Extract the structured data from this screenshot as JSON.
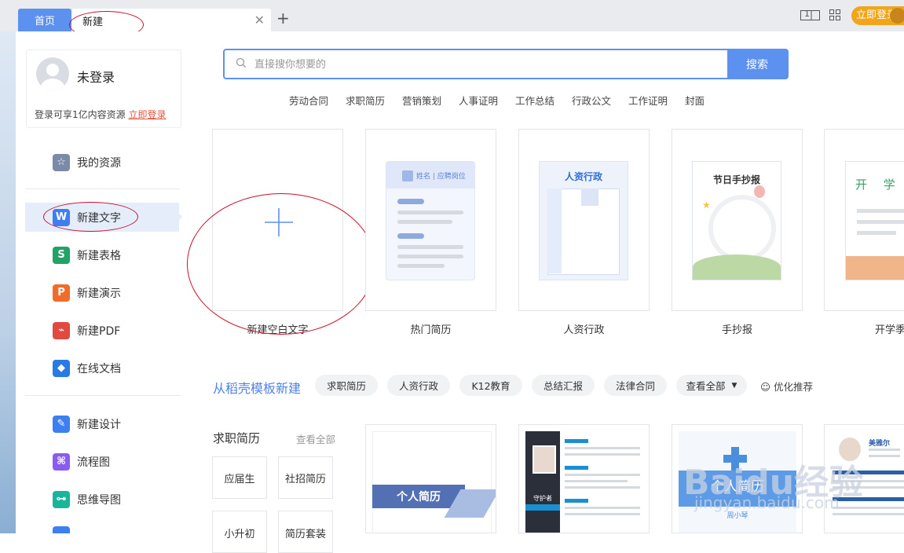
{
  "tabs": {
    "home": "首页",
    "new": "新建"
  },
  "top_right": {
    "screen_icon_label": "1",
    "login": "立即登录"
  },
  "user": {
    "name": "未登录",
    "tip_prefix": "登录可享1亿内容资源",
    "tip_link": "立即登录"
  },
  "sidebar": {
    "items": [
      {
        "label": "我的资源",
        "icon": "star-icon",
        "color": "#7b8aa6"
      },
      {
        "label": "新建文字",
        "icon": "w-icon",
        "color": "#3f7ef0"
      },
      {
        "label": "新建表格",
        "icon": "s-icon",
        "color": "#21a366"
      },
      {
        "label": "新建演示",
        "icon": "p-icon",
        "color": "#ef6c2b"
      },
      {
        "label": "新建PDF",
        "icon": "pdf-icon",
        "color": "#e24a3f"
      },
      {
        "label": "在线文档",
        "icon": "cube-icon",
        "color": "#2a7ae4"
      },
      {
        "label": "新建设计",
        "icon": "design-icon",
        "color": "#3d7ef0"
      },
      {
        "label": "流程图",
        "icon": "flowchart-icon",
        "color": "#8a5cf0"
      },
      {
        "label": "思维导图",
        "icon": "mindmap-icon",
        "color": "#19b59a"
      }
    ]
  },
  "search": {
    "placeholder": "直接搜你想要的",
    "button": "搜索"
  },
  "hot_links": [
    "劳动合同",
    "求职简历",
    "营销策划",
    "人事证明",
    "工作总结",
    "行政公文",
    "工作证明",
    "封面"
  ],
  "cards": [
    {
      "label": "新建空白文字"
    },
    {
      "label": "热门简历",
      "inner": "姓名 | 应聘岗位"
    },
    {
      "label": "人资行政",
      "inner": "人资行政"
    },
    {
      "label": "手抄报",
      "inner": "节日手抄报"
    },
    {
      "label": "开学季",
      "inner": "开 学"
    }
  ],
  "template_section": {
    "title": "从稻壳模板新建",
    "chips": [
      "求职简历",
      "人资行政",
      "K12教育",
      "总结汇报",
      "法律合同",
      "查看全部"
    ],
    "recommend": "优化推荐"
  },
  "resume_section": {
    "title": "求职简历",
    "view_all": "查看全部",
    "tags": [
      "应届生",
      "社招简历",
      "小升初",
      "简历套装"
    ],
    "thumbs": [
      {
        "text": "个人简历"
      },
      {
        "text": "守护者"
      },
      {
        "text": "个人简历",
        "sub": "周小琴"
      },
      {
        "text": "美雅尔"
      }
    ]
  },
  "watermark": {
    "text": "Baidu经验",
    "sub": "jingyan.baidu.com"
  },
  "colors": {
    "accent": "#5d91f0",
    "orange": "#f2a51a",
    "link_red": "#e8553e",
    "annotation": "#c8102e"
  }
}
